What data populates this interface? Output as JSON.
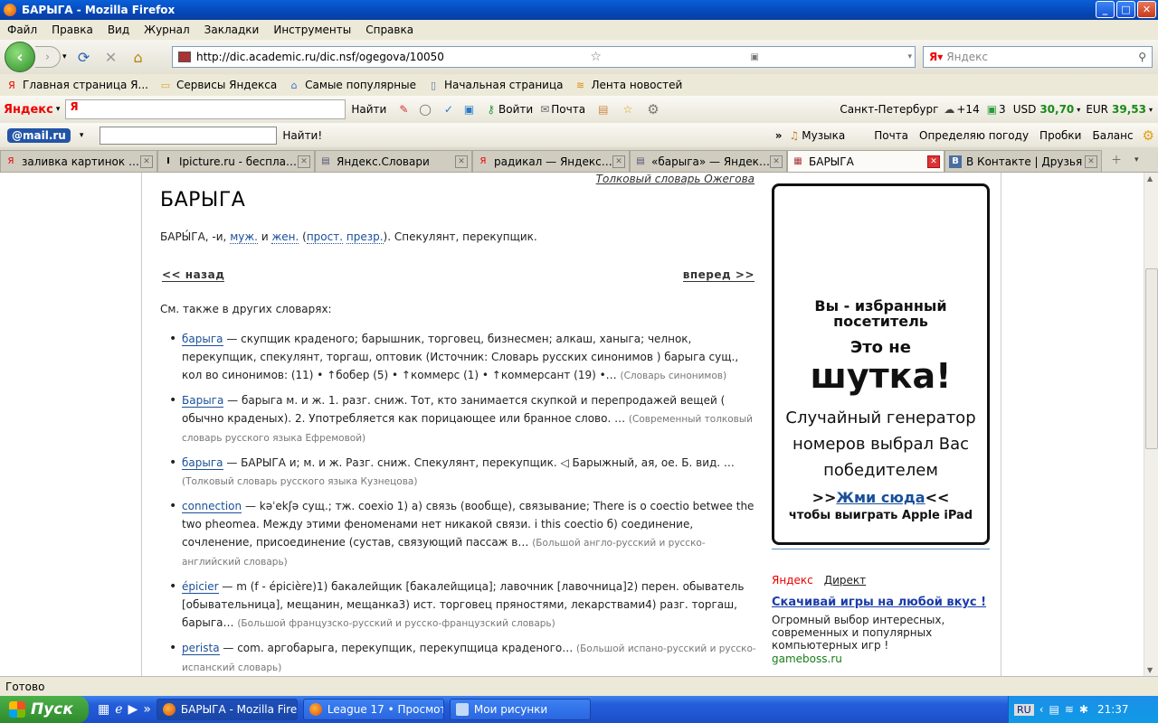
{
  "window": {
    "title": "БАРЫГА - Mozilla Firefox",
    "minimize": "_",
    "maximize": "□",
    "close": "✕"
  },
  "menu": [
    "Файл",
    "Правка",
    "Вид",
    "Журнал",
    "Закладки",
    "Инструменты",
    "Справка"
  ],
  "nav": {
    "back": "‹",
    "forward": "›",
    "url": "http://dic.academic.ru/dic.nsf/ogegova/10050",
    "search_placeholder": "Яндекс"
  },
  "bookmarks": [
    {
      "label": "Главная страница Я...",
      "icon": "Я",
      "color": "#e00"
    },
    {
      "label": "Сервисы Яндекса",
      "icon": "▭",
      "color": "#d9a52b"
    },
    {
      "label": "Самые популярные",
      "icon": "⌂",
      "color": "#3a6fc4"
    },
    {
      "label": "Начальная страница",
      "icon": "▯",
      "color": "#5577aa"
    },
    {
      "label": "Лента новостей",
      "icon": "≋",
      "color": "#e08a12"
    }
  ],
  "yabar": {
    "logo": "Яндекс",
    "find": "Найти",
    "login": "Войти",
    "mail": "Почта",
    "city": "Санкт-Петербург",
    "temp": "+14",
    "count": "3",
    "usd_label": "USD",
    "usd": "30,70",
    "eur_label": "EUR",
    "eur": "39,53"
  },
  "mailbar": {
    "logo": "@mail.ru",
    "find": "Найти!",
    "music": "Музыка",
    "links": [
      "Почта",
      "Определяю погоду",
      "Пробки",
      "Баланс"
    ]
  },
  "tabs": [
    {
      "label": "заливка картинок — ...",
      "icon": "Я",
      "active": false
    },
    {
      "label": "Ipicture.ru - бесплатн...",
      "icon": "I",
      "active": false
    },
    {
      "label": "Яндекс.Словари",
      "icon": "▤",
      "active": false
    },
    {
      "label": "радикал — Яндекс: Н...",
      "icon": "Я",
      "active": false
    },
    {
      "label": "«барыга» — Яндекс.С...",
      "icon": "▤",
      "active": false
    },
    {
      "label": "БАРЫГА",
      "icon": "▦",
      "active": true
    },
    {
      "label": "В Контакте | Друзья",
      "icon": "В",
      "active": false
    }
  ],
  "page": {
    "dict_source": "Толковый словарь Ожегова",
    "title": "БАРЫГА",
    "definition": {
      "head": "БАРЫ́ГА, -и,",
      "l1": "муж.",
      "and": "и",
      "l2": "жен.",
      "l3": "прост.",
      "l4": "презр.",
      "tail": "). Спекулянт, перекупщик."
    },
    "prev": "<< назад",
    "next": "вперед >>",
    "see_also": "См. также в других словарях:",
    "entries": [
      {
        "term": "барыга",
        "text": " — скупщик краденого; барышник, торговец, бизнесмен; алкаш, ханыга; челнок, перекупщик, спекулянт, торгаш, оптовик (Источник: Словарь русских синонимов ) барыга сущ., кол во синонимов: (11) • ↑бобер (5) • ↑коммерс (1) • ↑коммерсант (19) •… ",
        "source": "(Словарь синонимов)"
      },
      {
        "term": "Барыга",
        "text": " — барыга м. и ж. 1. разг. сниж. Тот, кто занимается скупкой и перепродажей вещей ( обычно краденых). 2. Употребляется как порицающее или бранное слово. … ",
        "source": "(Современный толковый словарь русского языка Ефремовой)"
      },
      {
        "term": "барыга",
        "text": " — БАРЫГА и; м. и ж. Разг. сниж. Спекулянт, перекупщик. ◁ Барыжный, ая, ое. Б. вид. … ",
        "source": "(Толковый словарь русского языка Кузнецова)"
      },
      {
        "term": "connection",
        "text": " — kəˈekʃə сущ.; тж. coexio 1) а) связь (вообще), связывание; There is o coectio betwee the two pheomea. Между этими феноменами нет никакой связи. i this coectio б) соединение, сочленение, присоединение (сустав, связующий пассаж в… ",
        "source": "(Большой англо-русский и русско-английский словарь)"
      },
      {
        "term": "épicier",
        "text": " — m (f - épicière)1) бакалейщик [бакалейщица]; лавочник [лавочница]2) перен. обыватель [обывательница], мещанин, мещанка3) ист. торговец пряностями, лекарствами4) разг. торгаш, барыга… ",
        "source": "(Большой французско-русский и русско-французский словарь)"
      },
      {
        "term": "perista",
        "text": " — com. аргобарыга, перекупщик, перекупщица краденого… ",
        "source": "(Большой испано-русский и русско-испанский словарь)"
      }
    ]
  },
  "ad": {
    "line1": "Вы - избранный посетитель",
    "line2": "Это не",
    "line3": "шутка!",
    "line4": "Случайный генератор номеров выбрал Вас победителем",
    "cta_pre": ">>",
    "cta": "Жми сюда",
    "cta_post": "<<",
    "line6": "чтобы выиграть Apple iPad"
  },
  "direct": {
    "yandex": "Яндекс",
    "direct": "Директ",
    "headline": "Скачивай игры на любой вкус !",
    "text": "Огромный выбор интересных, современных и популярных компьютерных игр !",
    "domain": "gameboss.ru"
  },
  "status": "Готово",
  "taskbar": {
    "start": "Пуск",
    "tasks": [
      "БАРЫГА - Mozilla Fire...",
      "League 17 • Просмот...",
      "Мои рисунки"
    ],
    "lang": "RU",
    "time": "21:37"
  }
}
